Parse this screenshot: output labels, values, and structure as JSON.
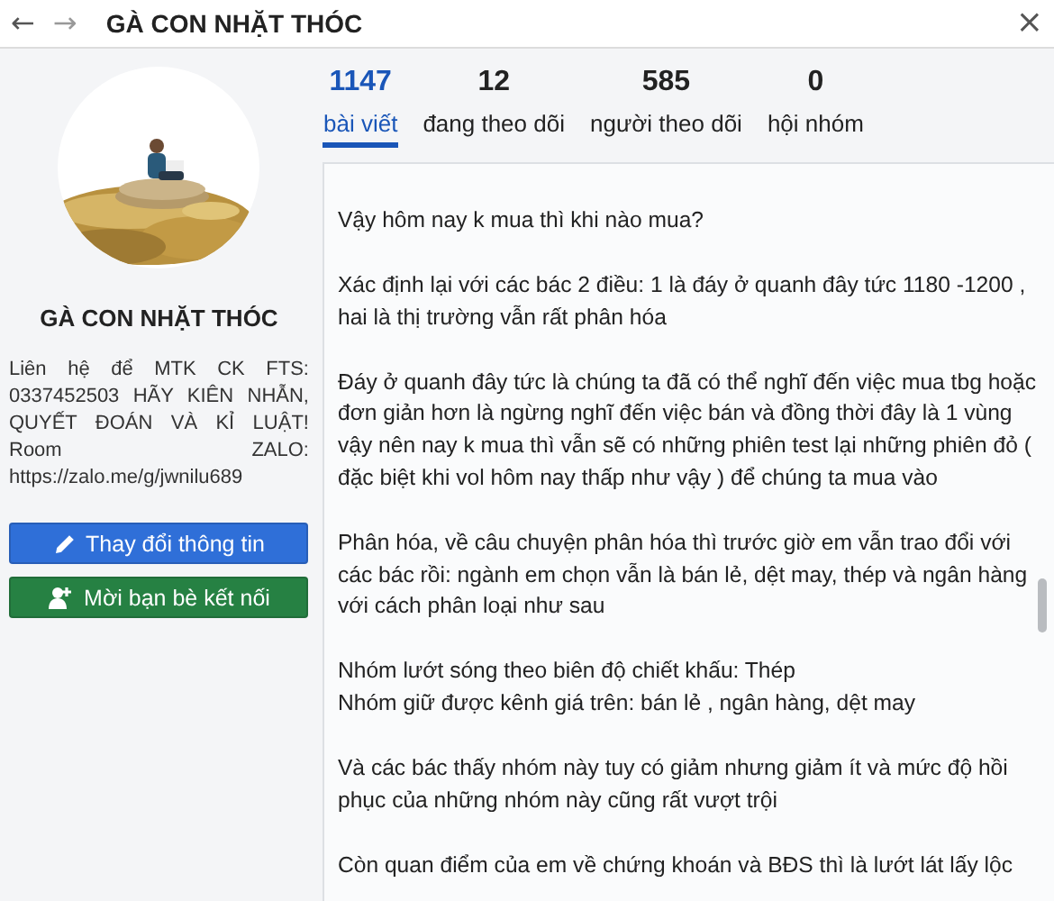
{
  "header": {
    "back": "←",
    "forward": "→",
    "title": "GÀ CON NHẶT THÓC",
    "close": "×"
  },
  "profile": {
    "name": "GÀ CON NHẶT THÓC",
    "bio": "Liên hệ để MTK CK FTS: 0337452503 HÃY KIÊN NHẪN, QUYẾT ĐOÁN VÀ KỈ LUẬT! Room ZALO: https://zalo.me/g/jwnilu689",
    "buttons": [
      {
        "label": "Thay đổi thông tin",
        "kind": "edit"
      },
      {
        "label": "Mời bạn bè kết nối",
        "kind": "invite"
      }
    ]
  },
  "stats": [
    {
      "count": "1147",
      "label": "bài viết",
      "selected": true
    },
    {
      "count": "12",
      "label": "đang theo dõi",
      "selected": false
    },
    {
      "count": "585",
      "label": "người theo dõi",
      "selected": false
    },
    {
      "count": "0",
      "label": "hội nhóm",
      "selected": false
    }
  ],
  "post": {
    "paragraphs": [
      [
        "Vậy hôm nay k mua thì khi nào mua?"
      ],
      [
        "Xác định lại với các bác 2 điều: 1 là đáy ở quanh đây tức 1180 -1200 ,",
        "hai là thị trường vẫn rất phân hóa"
      ],
      [
        "Đáy ở quanh đây tức là chúng ta đã có thể nghĩ đến việc mua tbg hoặc",
        "đơn giản hơn là ngừng nghĩ đến việc bán và đồng thời đây là 1 vùng",
        "vậy nên nay k mua thì vẫn sẽ có những phiên test lại những phiên đỏ (",
        "đặc biệt khi vol hôm nay thấp như vậy ) để chúng ta mua vào"
      ],
      [
        "Phân hóa, về câu chuyện phân hóa thì trước giờ em vẫn trao đổi với",
        "các bác rồi: ngành em chọn vẫn là bán lẻ, dệt may, thép và ngân hàng",
        "với cách phân loại như sau"
      ],
      [
        "Nhóm lướt sóng theo biên độ chiết khấu: Thép",
        "Nhóm giữ được kênh giá trên: bán lẻ , ngân hàng, dệt may"
      ],
      [
        "Và các bác thấy nhóm này tuy có giảm nhưng giảm ít và mức độ hồi",
        "phục của những nhóm này cũng rất vượt trội"
      ],
      [
        "Còn quan điểm của em về chứng khoán và BĐS thì là lướt lát lấy lộc"
      ]
    ]
  }
}
